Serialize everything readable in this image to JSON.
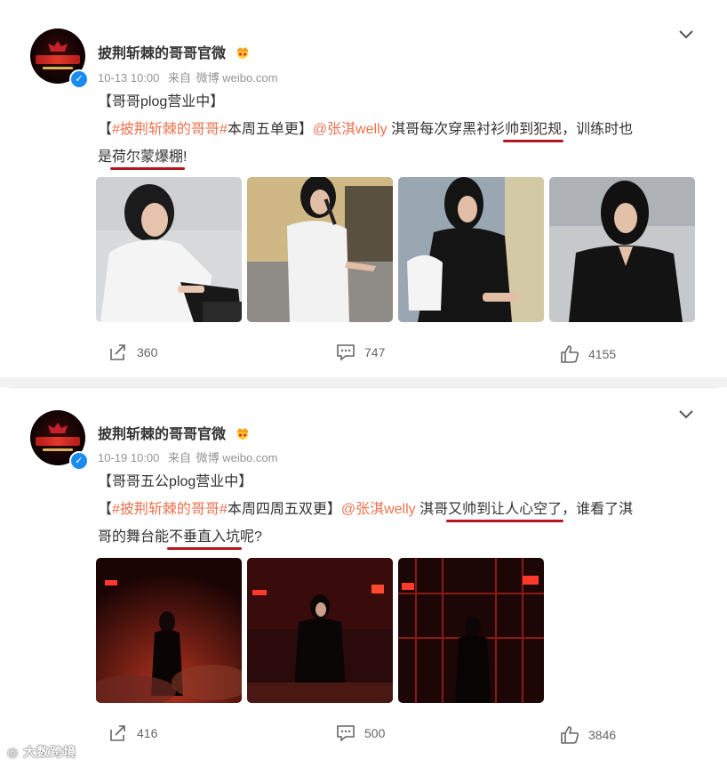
{
  "posts": [
    {
      "author": "披荆斩棘的哥哥官微",
      "time": "10-13 10:00",
      "source_prefix": "来自",
      "source": "微博 weibo.com",
      "line1": "【哥哥plog营业中】",
      "l2_bracket_open": "【",
      "topic": "#披荆斩棘的哥哥#",
      "l2_text": "本周五单更】",
      "mention": "@张淇welly",
      "l2_text2": " 淇哥每次穿黑衬衫",
      "highlight1": "帅到犯规",
      "l2_text3": "，训练时也",
      "l3_prefix": "是",
      "highlight2": "荷尔蒙爆棚",
      "l3_suffix": "!",
      "photos": [
        "photo-piano-white-shirt",
        "photo-mic-white-shirt",
        "photo-black-shirt-seated",
        "photo-black-shirt-portrait"
      ],
      "reposts": "360",
      "comments": "747",
      "likes": "4155"
    },
    {
      "author": "披荆斩棘的哥哥官微",
      "time": "10-19 10:00",
      "source_prefix": "来自",
      "source": "微博 weibo.com",
      "line1": "【哥哥五公plog营业中】",
      "l2_bracket_open": "【",
      "topic": "#披荆斩棘的哥哥#",
      "l2_text": "本周四周五双更】",
      "mention": "@张淇welly",
      "l2_text2": " 淇哥",
      "highlight1": "又帅到让人心空了",
      "l2_text3": "，谁看了淇",
      "l3_prefix": "哥的舞台能",
      "highlight2": "不垂直入坑",
      "l3_suffix": "呢?",
      "photos": [
        "photo-stage-red-smoke",
        "photo-stage-mic-center",
        "photo-stage-red-grid"
      ],
      "reposts": "416",
      "comments": "500",
      "likes": "3846"
    }
  ],
  "watermark": "大数跨境",
  "colors": {
    "link": "#eb7350",
    "underline": "#b3171f",
    "badge": "#1a8cf0",
    "muted": "#939393"
  },
  "icons": [
    "verified-badge-icon",
    "crown-emoji-icon",
    "chevron-down-icon",
    "repost-icon",
    "comment-icon",
    "like-icon"
  ]
}
